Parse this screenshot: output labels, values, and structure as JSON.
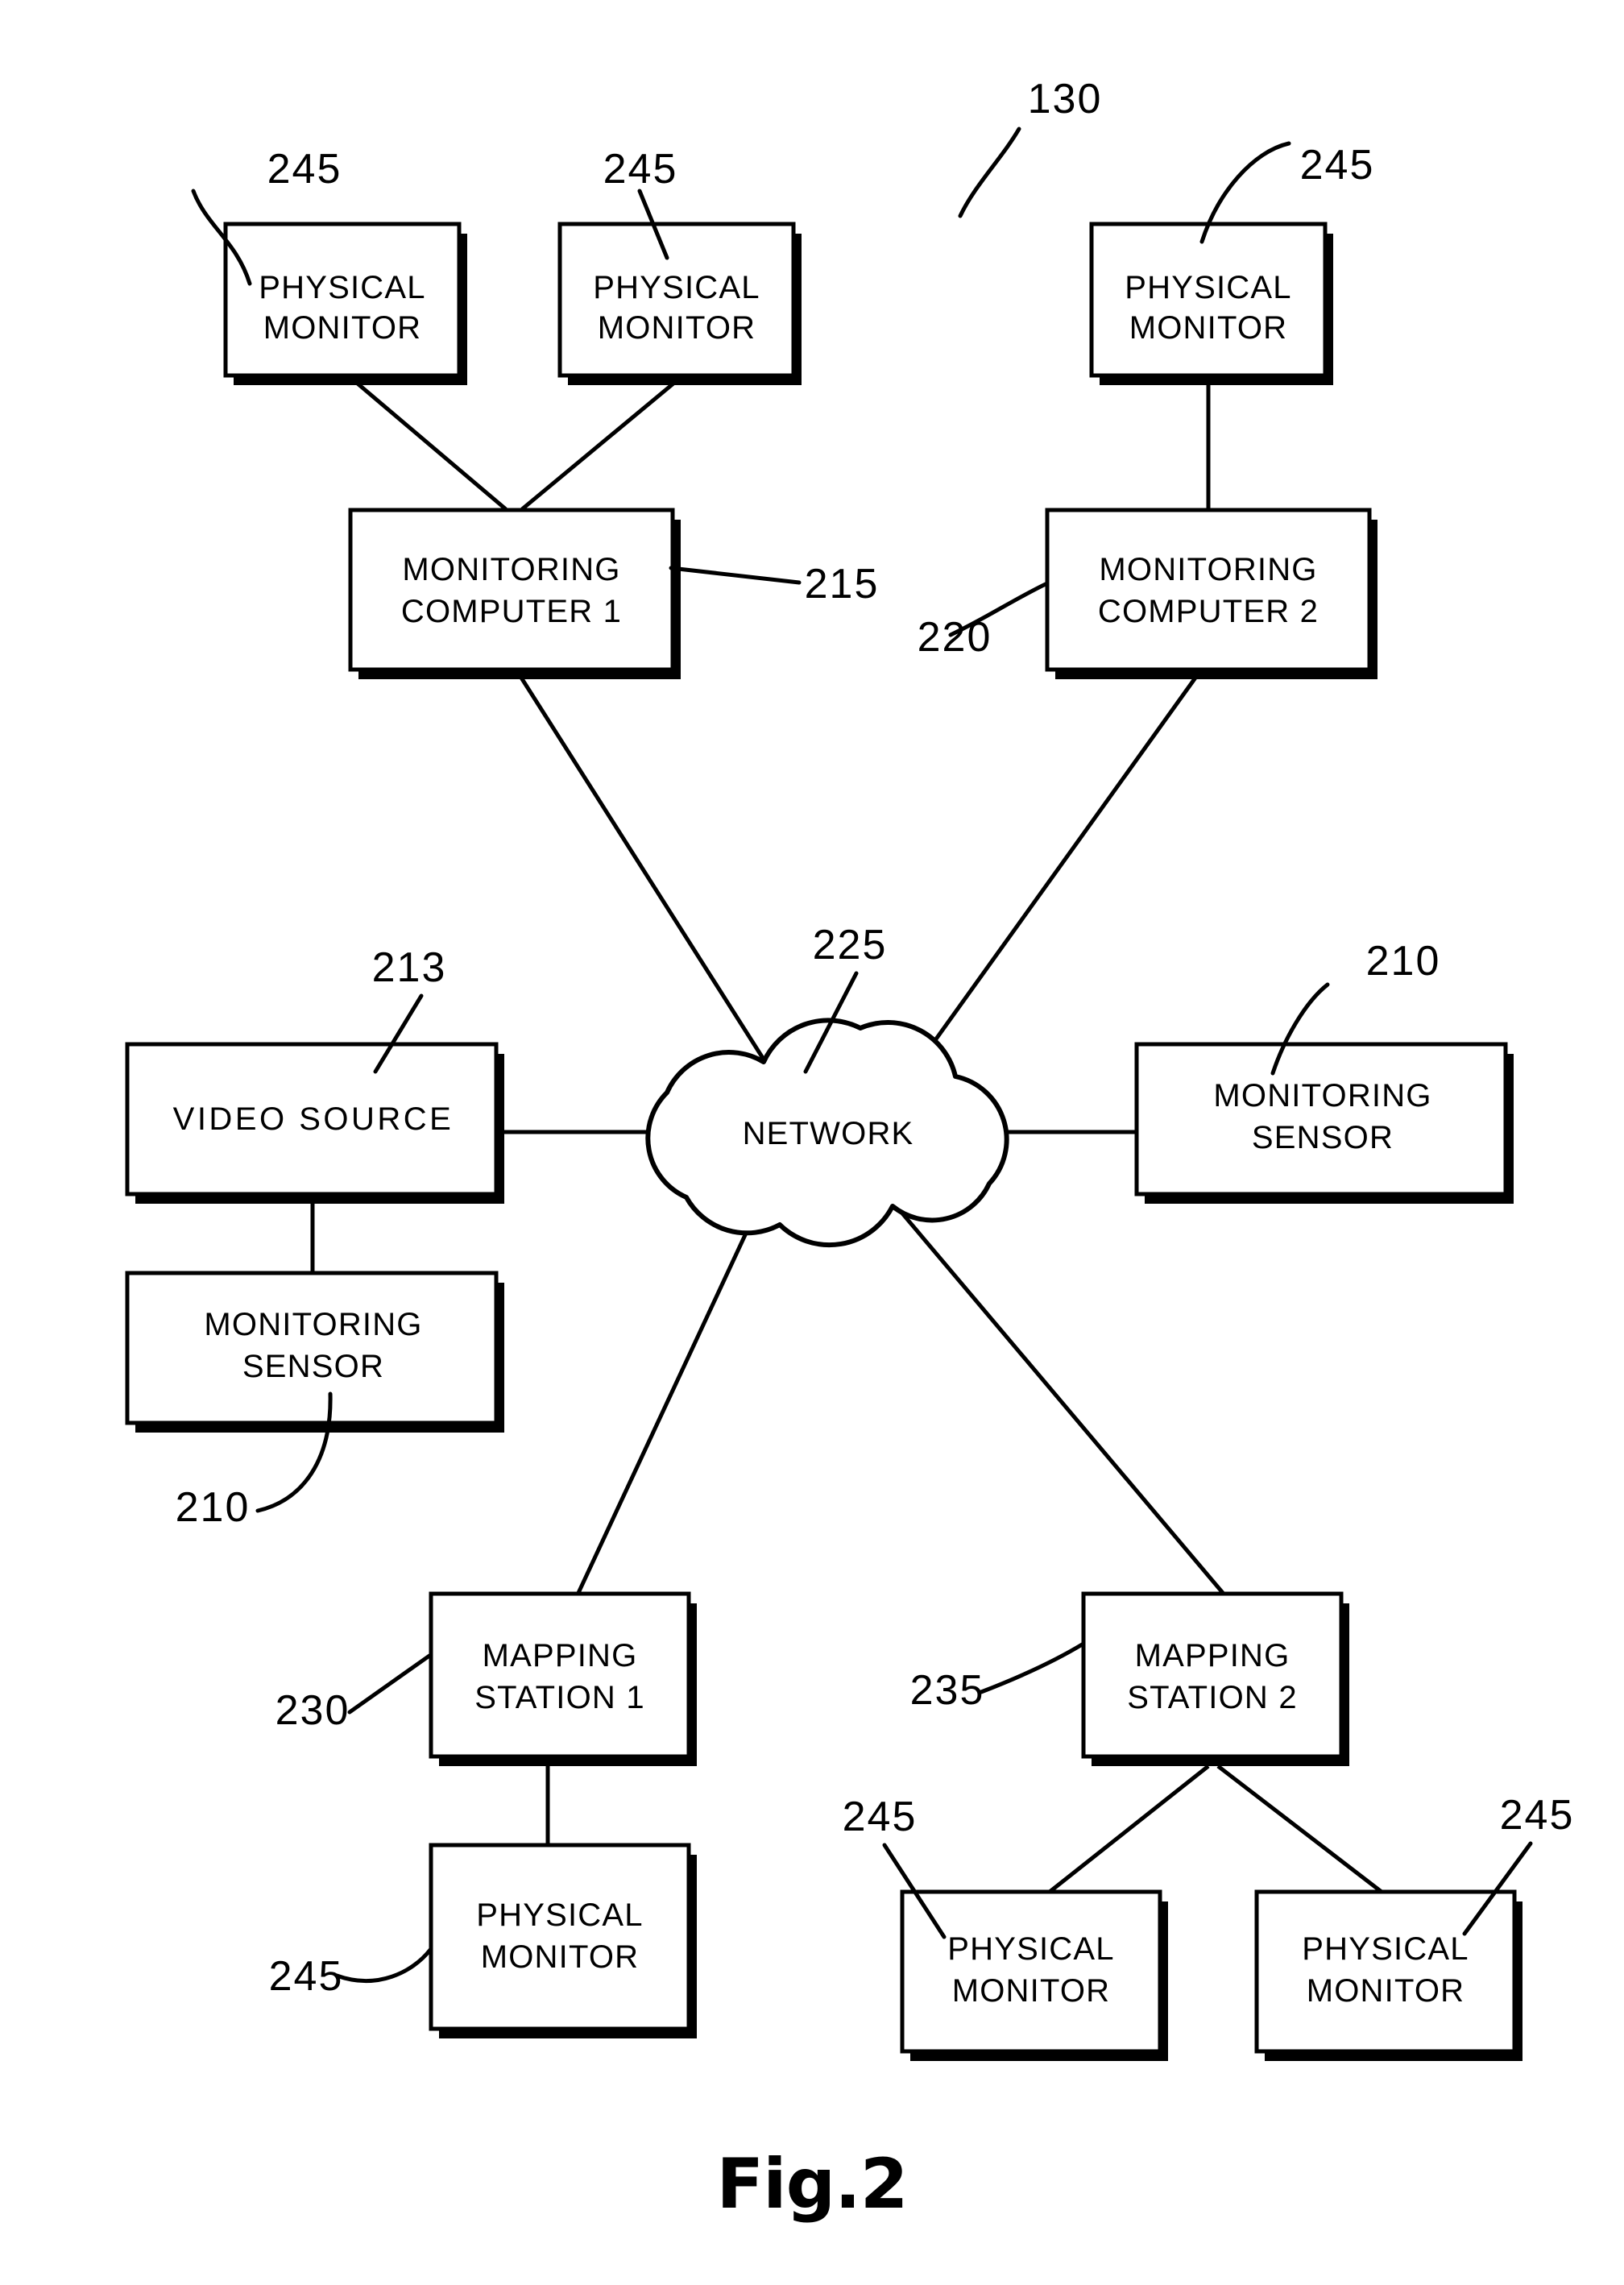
{
  "figure": {
    "caption": "Fig.2",
    "system_ref": "130"
  },
  "nodes": [
    {
      "id": "pm-top-1",
      "line1": "PHYSICAL",
      "line2": "MONITOR",
      "ref": "245"
    },
    {
      "id": "pm-top-2",
      "line1": "PHYSICAL",
      "line2": "MONITOR",
      "ref": "245"
    },
    {
      "id": "pm-top-3",
      "line1": "PHYSICAL",
      "line2": "MONITOR",
      "ref": "245"
    },
    {
      "id": "mc-1",
      "line1": "MONITORING",
      "line2": "COMPUTER  1",
      "ref": "215"
    },
    {
      "id": "mc-2",
      "line1": "MONITORING",
      "line2": "COMPUTER  2",
      "ref": "220"
    },
    {
      "id": "video-src",
      "line1": "VIDEO  SOURCE",
      "line2": "",
      "ref": "213"
    },
    {
      "id": "ms-left",
      "line1": "MONITORING",
      "line2": "SENSOR",
      "ref": "210"
    },
    {
      "id": "ms-right",
      "line1": "MONITORING",
      "line2": "SENSOR",
      "ref": "210"
    },
    {
      "id": "network",
      "line1": "NETWORK",
      "line2": "",
      "ref": "225"
    },
    {
      "id": "map-1",
      "line1": "MAPPING",
      "line2": "STATION  1",
      "ref": "230"
    },
    {
      "id": "map-2",
      "line1": "MAPPING",
      "line2": "STATION  2",
      "ref": "235"
    },
    {
      "id": "pm-bot-1",
      "line1": "PHYSICAL",
      "line2": "MONITOR",
      "ref": "245"
    },
    {
      "id": "pm-bot-2",
      "line1": "PHYSICAL",
      "line2": "MONITOR",
      "ref": "245"
    },
    {
      "id": "pm-bot-3",
      "line1": "PHYSICAL",
      "line2": "MONITOR",
      "ref": "245"
    }
  ],
  "colors": {
    "ink": "#000000",
    "paper": "#ffffff"
  }
}
